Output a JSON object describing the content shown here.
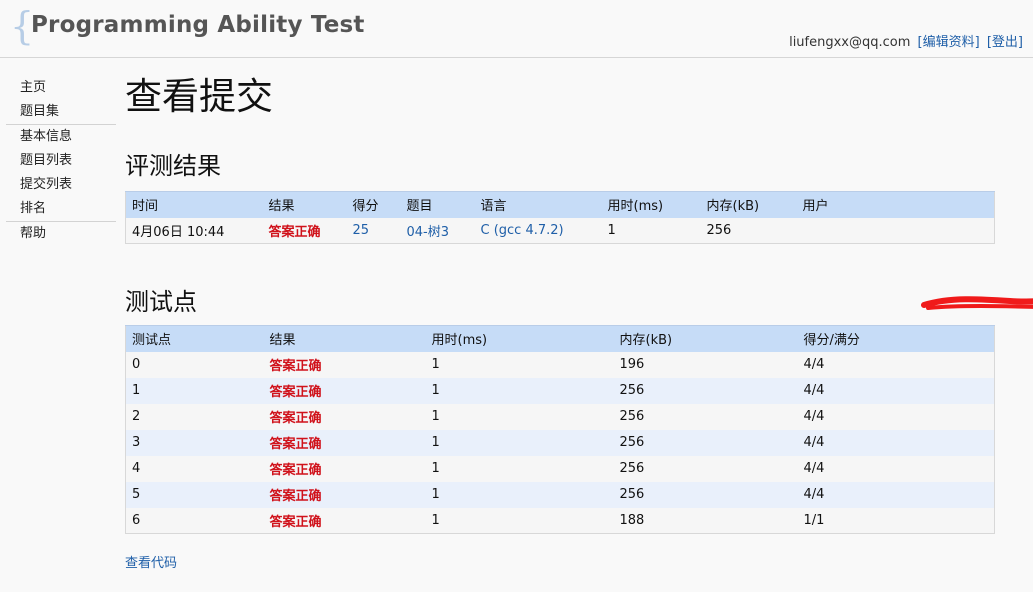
{
  "header": {
    "brace": "{",
    "title": "Programming Ability Test",
    "user_email": "liufengxx@qq.com",
    "edit_profile": "[编辑资料]",
    "logout": "[登出]"
  },
  "sidebar": {
    "items": [
      "主页",
      "题目集",
      "基本信息",
      "题目列表",
      "提交列表",
      "排名",
      "帮助"
    ]
  },
  "main": {
    "page_title": "查看提交",
    "result_section_title": "评测结果",
    "result_headers": [
      "时间",
      "结果",
      "得分",
      "题目",
      "语言",
      "用时(ms)",
      "内存(kB)",
      "用户"
    ],
    "result_row": {
      "time": "4月06日 10:44",
      "result": "答案正确",
      "score": "25",
      "problem": "04-树3",
      "language": "C (gcc 4.7.2)",
      "time_ms": "1",
      "memory_kb": "256",
      "user": ""
    },
    "tests_section_title": "测试点",
    "tests_headers": [
      "测试点",
      "结果",
      "用时(ms)",
      "内存(kB)",
      "得分/满分"
    ],
    "tests_rows": [
      {
        "id": "0",
        "result": "答案正确",
        "time": "1",
        "mem": "196",
        "score": "4/4"
      },
      {
        "id": "1",
        "result": "答案正确",
        "time": "1",
        "mem": "256",
        "score": "4/4"
      },
      {
        "id": "2",
        "result": "答案正确",
        "time": "1",
        "mem": "256",
        "score": "4/4"
      },
      {
        "id": "3",
        "result": "答案正确",
        "time": "1",
        "mem": "256",
        "score": "4/4"
      },
      {
        "id": "4",
        "result": "答案正确",
        "time": "1",
        "mem": "256",
        "score": "4/4"
      },
      {
        "id": "5",
        "result": "答案正确",
        "time": "1",
        "mem": "256",
        "score": "4/4"
      },
      {
        "id": "6",
        "result": "答案正确",
        "time": "1",
        "mem": "188",
        "score": "1/1"
      }
    ],
    "view_code": "查看代码"
  },
  "colors": {
    "accent_link": "#1f5fa8",
    "ok_red": "#d0121b",
    "table_header": "#c6dcf7",
    "row_alt": "#e9f0fb",
    "scribble": "#f01a1a"
  }
}
